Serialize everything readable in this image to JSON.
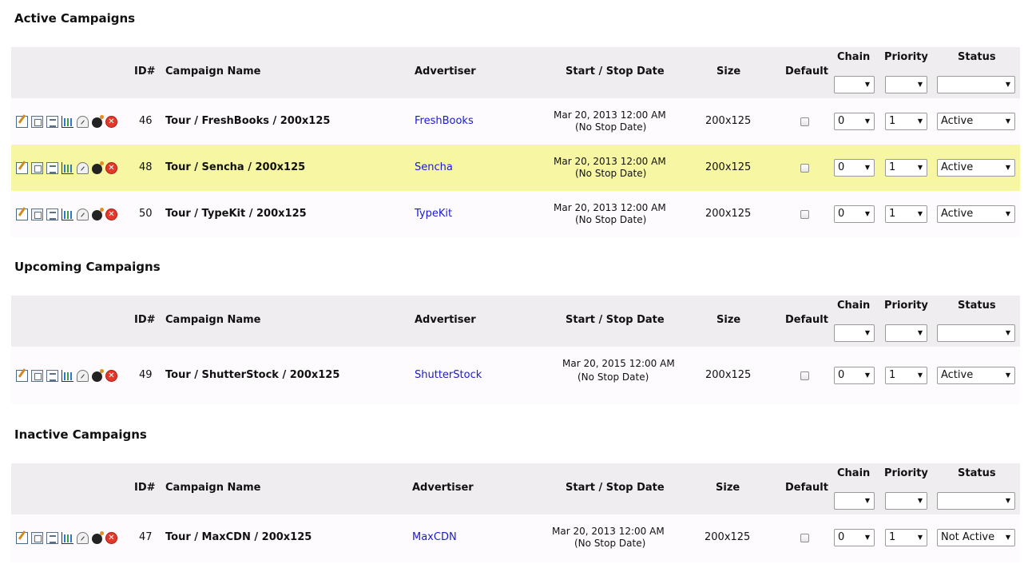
{
  "headers": {
    "id": "ID#",
    "name": "Campaign Name",
    "advertiser": "Advertiser",
    "date": "Start / Stop Date",
    "size": "Size",
    "default": "Default",
    "chain": "Chain",
    "priority": "Priority",
    "status": "Status"
  },
  "icon_names": [
    "edit-icon",
    "copy-icon",
    "report-icon",
    "stats-chart-icon",
    "gauge-icon",
    "bomb-icon",
    "delete-icon"
  ],
  "sections": [
    {
      "title": "Active Campaigns",
      "rows": [
        {
          "id": "46",
          "name": "Tour / FreshBooks / 200x125",
          "advertiser": "FreshBooks",
          "date": "Mar 20, 2013 12:00 AM",
          "stop": "(No Stop Date)",
          "size": "200x125",
          "chain": "0",
          "priority": "1",
          "status": "Active"
        },
        {
          "id": "48",
          "name": "Tour / Sencha / 200x125",
          "advertiser": "Sencha",
          "date": "Mar 20, 2013 12:00 AM",
          "stop": "(No Stop Date)",
          "size": "200x125",
          "chain": "0",
          "priority": "1",
          "status": "Active"
        },
        {
          "id": "50",
          "name": "Tour / TypeKit / 200x125",
          "advertiser": "TypeKit",
          "date": "Mar 20, 2013 12:00 AM",
          "stop": "(No Stop Date)",
          "size": "200x125",
          "chain": "0",
          "priority": "1",
          "status": "Active"
        }
      ]
    },
    {
      "title": "Upcoming Campaigns",
      "rows": [
        {
          "id": "49",
          "name": "Tour / ShutterStock / 200x125",
          "advertiser": "ShutterStock",
          "date": "Mar 20, 2015 12:00 AM",
          "stop": "(No Stop Date)",
          "size": "200x125",
          "chain": "0",
          "priority": "1",
          "status": "Active"
        }
      ]
    },
    {
      "title": "Inactive Campaigns",
      "rows": [
        {
          "id": "47",
          "name": "Tour / MaxCDN / 200x125",
          "advertiser": "MaxCDN",
          "date": "Mar 20, 2013 12:00 AM",
          "stop": "(No Stop Date)",
          "size": "200x125",
          "chain": "0",
          "priority": "1",
          "status": "Not Active"
        }
      ]
    }
  ],
  "colors": {
    "header_bg": "#efedf0",
    "row_bg": "#fdfbfd",
    "highlight_row_bg": "#f7f7a3",
    "link": "#1a1ad0"
  }
}
